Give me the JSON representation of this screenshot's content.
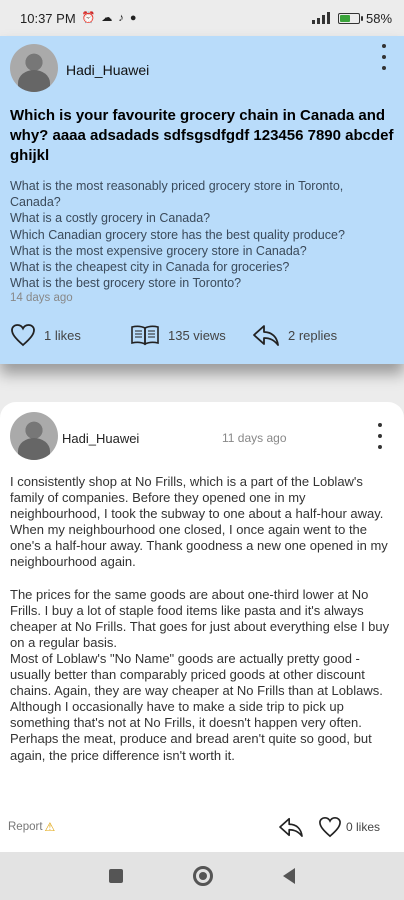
{
  "status_bar": {
    "time": "10:37 PM",
    "battery": "58",
    "battery_level": 0.58
  },
  "question": {
    "username": "Hadi_Huawei",
    "title": "Which is your favourite grocery chain in Canada and why?  aaaa adsadads  sdfsgsdfgdf 123456  7890 abcdef ghijkl",
    "related": [
      "What is the most reasonably priced grocery store in Toronto, Canada?",
      "What is a costly grocery in Canada?",
      "Which Canadian grocery store has the best quality produce?",
      "What is the most expensive grocery store in Canada?",
      "What is the cheapest city in Canada for groceries?",
      "What is the best grocery store in Toronto?"
    ],
    "date": "14 days ago",
    "likes": "1 likes",
    "views": "135 views",
    "replies": "2 replies"
  },
  "answer": {
    "username": "Hadi_Huawei",
    "date": "11 days ago",
    "paragraph1": "I consistently shop at No Frills, which is a part of the Loblaw's family of companies. Before they opened one in my neighbourhood, I took the subway to one about a half-hour away. When my neighbourhood one closed, I once again went to the one's a half-hour away. Thank goodness a new one opened in my neighbourhood again.",
    "paragraph2": "The prices for the same goods are about one-third lower at No Frills. I buy a lot of staple food items like pasta and it's always cheaper at No Frills. That goes for just about everything else I buy on a regular basis.",
    "paragraph3": "Most of Loblaw's \"No Name\" goods are actually pretty good - usually better than comparably priced goods at other discount chains. Again, they are way cheaper at No Frills than at Loblaws.",
    "paragraph4": "Although I occasionally have to make a side trip to pick up something that's not at No Frills, it doesn't happen very often. Perhaps the meat, produce and bread aren't quite so good, but again, the price difference isn't worth it.",
    "report": "Report",
    "likes": "0 likes"
  },
  "colors": {
    "question_bg": "#b9dcfa",
    "answer_bg": "#ffffff",
    "page_bg": "#ececec"
  }
}
